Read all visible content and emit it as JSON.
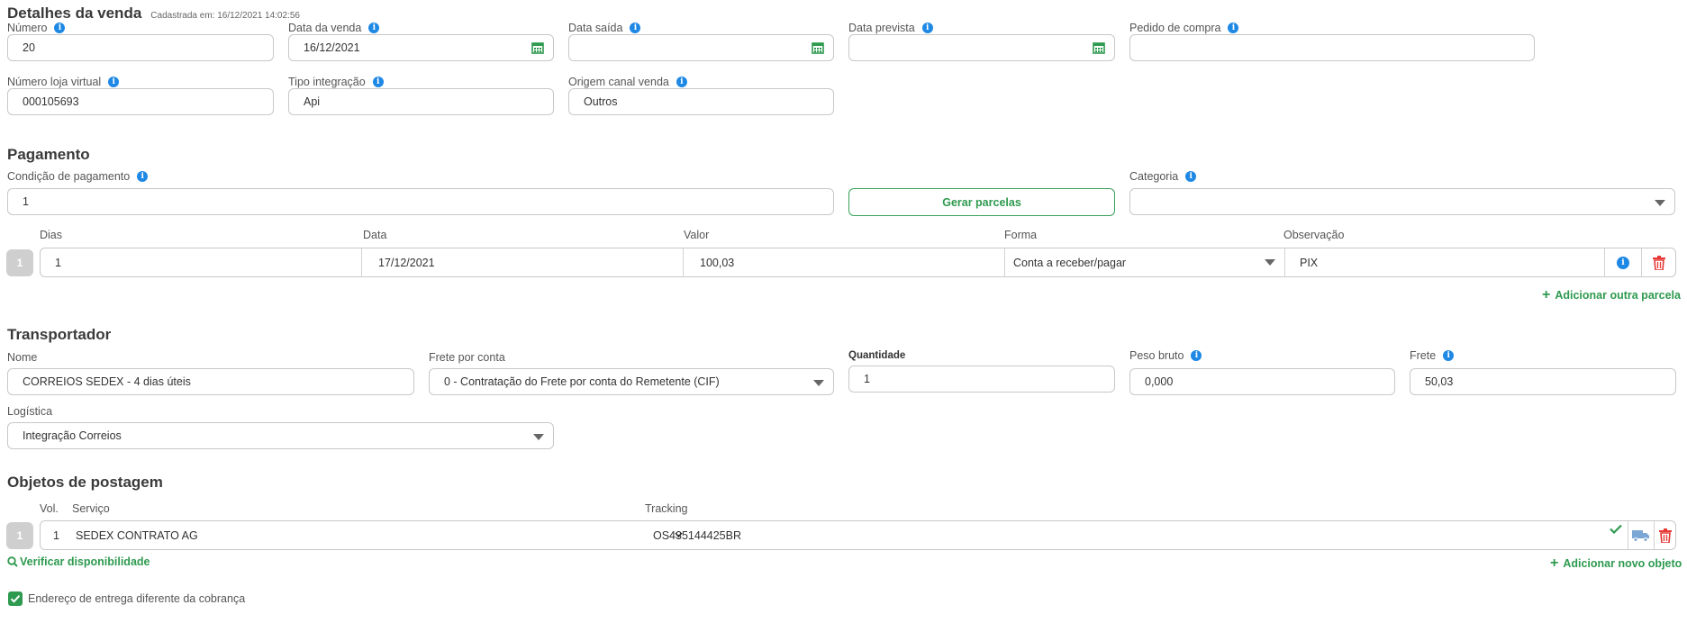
{
  "detalhes": {
    "title": "Detalhes da venda",
    "cadastrada": "Cadastrada em: 16/12/2021 14:02:56",
    "numero_label": "Número",
    "numero_value": "20",
    "data_venda_label": "Data da venda",
    "data_venda_value": "16/12/2021",
    "data_saida_label": "Data saída",
    "data_saida_value": "",
    "data_prevista_label": "Data prevista",
    "data_prevista_value": "",
    "pedido_compra_label": "Pedido de compra",
    "pedido_compra_value": "",
    "loja_virtual_label": "Número loja virtual",
    "loja_virtual_value": "000105693",
    "tipo_integracao_label": "Tipo integração",
    "tipo_integracao_value": "Api",
    "origem_label": "Origem canal venda",
    "origem_value": "Outros"
  },
  "pagamento": {
    "title": "Pagamento",
    "condicao_label": "Condição de pagamento",
    "condicao_value": "1",
    "gerar_parcelas": "Gerar parcelas",
    "categoria_label": "Categoria",
    "categoria_value": "",
    "columns": {
      "dias": "Dias",
      "data": "Data",
      "valor": "Valor",
      "forma": "Forma",
      "observacao": "Observação"
    },
    "parcelas": [
      {
        "num": "1",
        "dias": "1",
        "data": "17/12/2021",
        "valor": "100,03",
        "forma": "Conta a receber/pagar",
        "observacao": "PIX"
      }
    ],
    "adicionar": "Adicionar outra parcela"
  },
  "transportador": {
    "title": "Transportador",
    "nome_label": "Nome",
    "nome_value": "CORREIOS SEDEX - 4 dias úteis",
    "frete_conta_label": "Frete por conta",
    "frete_conta_value": "0 - Contratação do Frete por conta do Remetente (CIF)",
    "quantidade_label": "Quantidade",
    "quantidade_value": "1",
    "peso_label": "Peso bruto",
    "peso_value": "0,000",
    "frete_label": "Frete",
    "frete_value": "50,03",
    "logistica_label": "Logística",
    "logistica_value": "Integração Correios"
  },
  "objetos": {
    "title": "Objetos de postagem",
    "columns": {
      "vol": "Vol.",
      "servico": "Serviço",
      "tracking": "Tracking"
    },
    "items": [
      {
        "num": "1",
        "vol": "1",
        "servico": "SEDEX CONTRATO AG",
        "tracking": "OS435144425BR"
      }
    ],
    "verificar": "Verificar disponibilidade",
    "adicionar": "Adicionar novo objeto"
  },
  "endereco_diferente": "Endereço de entrega diferente da cobrança",
  "colors": {
    "accent_green": "#2e9a4f",
    "info_blue": "#1e88e5",
    "delete_red": "#e53935",
    "truck_blue": "#7aa7d6"
  }
}
